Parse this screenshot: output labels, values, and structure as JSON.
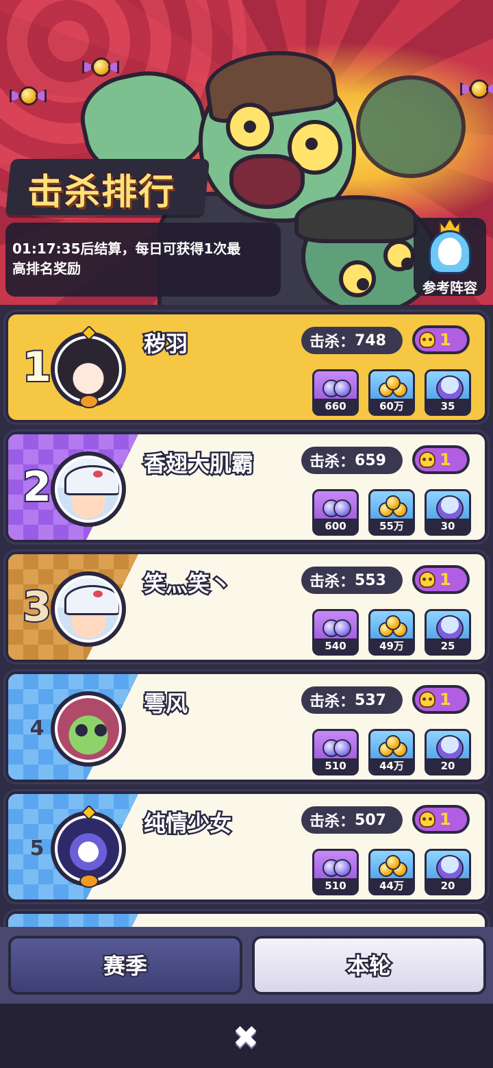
{
  "header": {
    "title": "击杀排行",
    "info_line1": "01:17:35后结算，每日可获得1次最",
    "info_line2": "高排名奖励",
    "ref_button": "参考阵容"
  },
  "kill_prefix": "击杀：",
  "rows": [
    {
      "rank": "1",
      "name": "秽羽",
      "kills": "748",
      "badge": "1",
      "rewards": [
        "660",
        "60万",
        "35"
      ]
    },
    {
      "rank": "2",
      "name": "香翅大肌霸",
      "kills": "659",
      "badge": "1",
      "rewards": [
        "600",
        "55万",
        "30"
      ]
    },
    {
      "rank": "3",
      "name": "笑灬笑丶",
      "kills": "553",
      "badge": "1",
      "rewards": [
        "540",
        "49万",
        "25"
      ]
    },
    {
      "rank": "4",
      "name": "雩风",
      "kills": "537",
      "badge": "1",
      "rewards": [
        "510",
        "44万",
        "20"
      ]
    },
    {
      "rank": "5",
      "name": "纯情少女",
      "kills": "507",
      "badge": "1",
      "rewards": [
        "510",
        "44万",
        "20"
      ]
    }
  ],
  "tabs": {
    "season": "赛季",
    "round": "本轮"
  },
  "close_symbol": "✖",
  "colors": {
    "rank1_bg": "#f6c743",
    "card_bg": "#fbf8ea",
    "badge_purple": "#b15ee0",
    "accent_gold": "#ffe27a"
  }
}
